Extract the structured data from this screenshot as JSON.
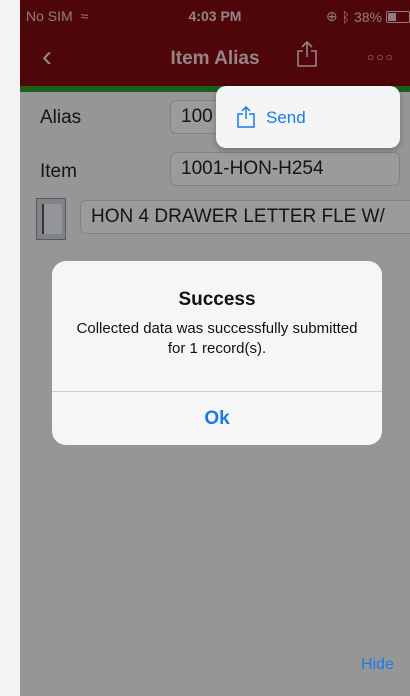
{
  "status_bar": {
    "carrier": "No SIM",
    "wifi_icon": "wifi-icon",
    "time": "4:03 PM",
    "right_icons": [
      "orientation-lock-icon",
      "bluetooth-icon"
    ],
    "battery_percent": "38%",
    "battery_level": 0.38
  },
  "nav": {
    "back_icon": "chevron-left-icon",
    "title": "Item Alias",
    "share_icon": "share-icon",
    "more_icon": "more-dots-icon"
  },
  "form": {
    "alias_label": "Alias",
    "alias_value": "100",
    "item_label": "Item",
    "item_value": "1001-HON-H254",
    "description_value": "HON 4 DRAWER LETTER FLE W/"
  },
  "popover": {
    "send_icon": "share-icon",
    "send_label": "Send"
  },
  "alert": {
    "title": "Success",
    "message": "Collected data was successfully submitted for 1 record(s).",
    "ok_label": "Ok"
  },
  "keyboard": {
    "hide_label": "Hide"
  },
  "colors": {
    "nav_bar": "#7f0b12",
    "accent_green": "#2e9b2e",
    "link_blue": "#1a7ae8"
  }
}
